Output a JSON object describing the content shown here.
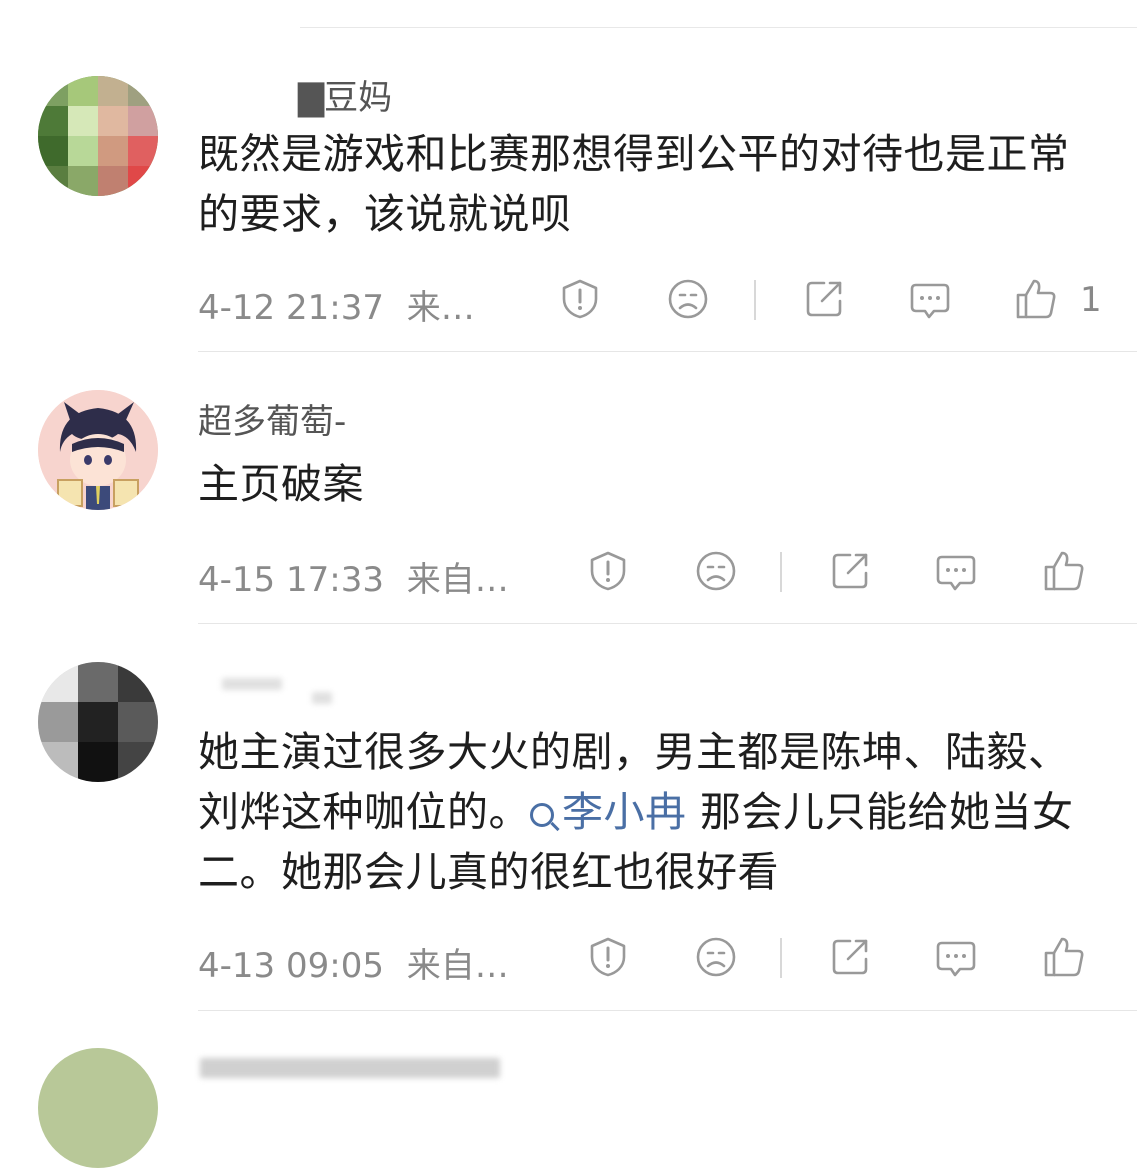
{
  "comments": [
    {
      "username": "▇豆妈",
      "text": "既然是游戏和比赛那想得到公平的对待也是正常的要求，该说就说呗",
      "timestamp": "4-12 21:37",
      "source": "来…",
      "likes": "1"
    },
    {
      "username": "超多葡萄-",
      "text": "主页破案",
      "timestamp": "4-15 17:33",
      "source": "来自…",
      "likes": ""
    },
    {
      "username": "",
      "text_before": "她主演过很多大火的剧，男主都是陈坤、陆毅、刘烨这种咖位的。",
      "mention": "李小冉",
      "text_after": " 那会儿只能给她当女二。她那会儿真的很红也很好看",
      "timestamp": "4-13 09:05",
      "source": "来自…",
      "likes": ""
    }
  ],
  "icons": [
    "report-icon",
    "sad-face-icon",
    "share-icon",
    "comment-icon",
    "thumbs-up-icon"
  ],
  "colors": {
    "mention": "#4a6fa5",
    "meta": "#8a8a8a",
    "text": "#1e1e1e"
  }
}
